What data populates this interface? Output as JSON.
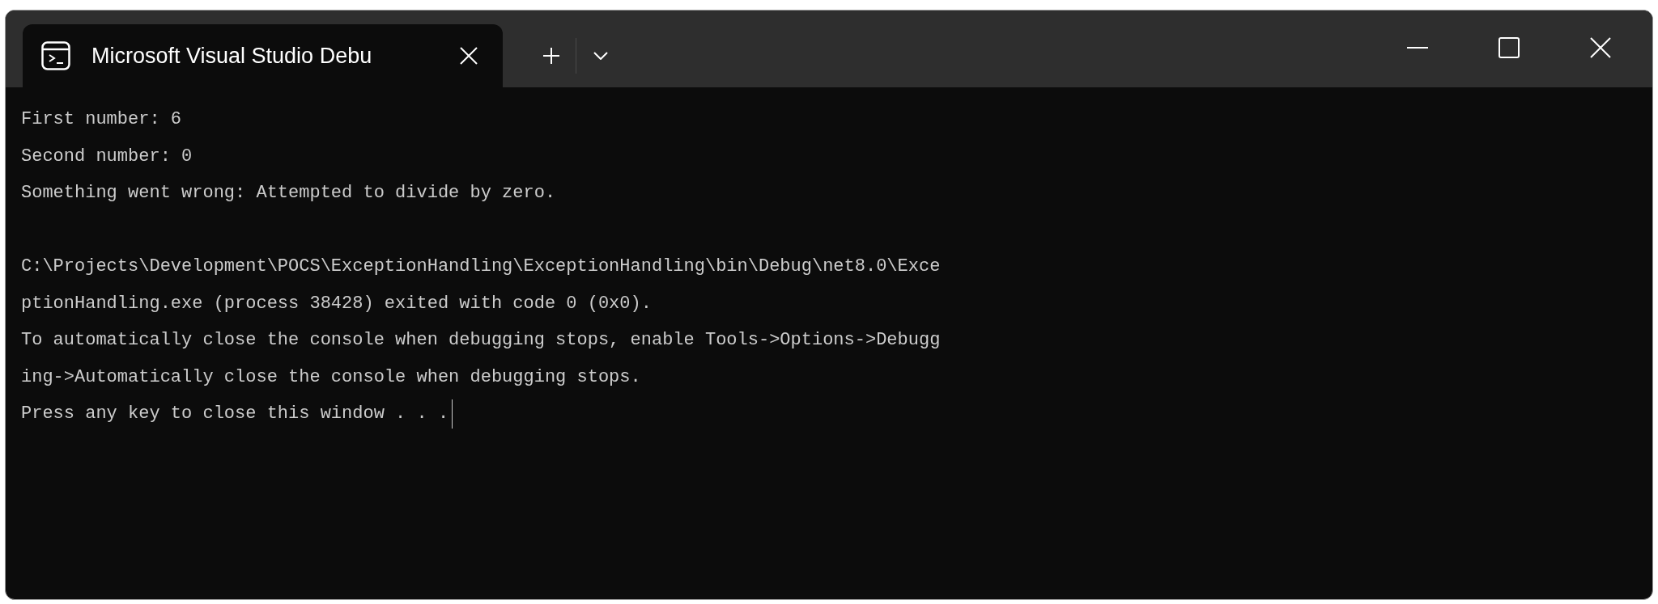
{
  "tabs": [
    {
      "title": "Microsoft Visual Studio Debu",
      "selected": true
    }
  ],
  "console": {
    "blocks": [
      [
        "First number: 6",
        "Second number: 0",
        "Something went wrong: Attempted to divide by zero."
      ],
      [
        "C:\\Projects\\Development\\POCS\\ExceptionHandling\\ExceptionHandling\\bin\\Debug\\net8.0\\Exce",
        "ptionHandling.exe (process 38428) exited with code 0 (0x0).",
        "To automatically close the console when debugging stops, enable Tools->Options->Debugg",
        "ing->Automatically close the console when debugging stops.",
        "Press any key to close this window . . ."
      ]
    ]
  }
}
